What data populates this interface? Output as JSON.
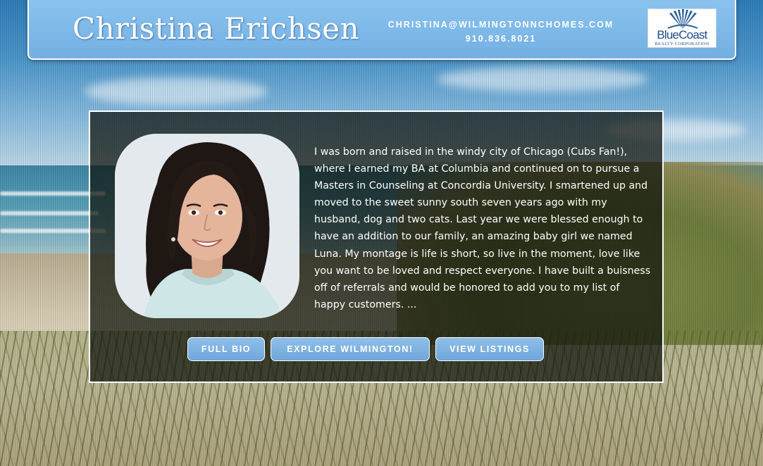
{
  "header": {
    "agent_name": "Christina Erichsen",
    "email": "CHRISTINA@WILMINGTONNCHOMES.COM",
    "phone": "910.836.8021",
    "logo_name": "BlueCoast",
    "logo_subtitle": "REALTY CORPORATION"
  },
  "bio": {
    "text": "I was born and raised in the windy city of Chicago (Cubs Fan!), where I earned my BA at Columbia and continued on to pursue a Masters in Counseling at Concordia University. I smartened up and moved to the sweet sunny south seven years ago with my husband, dog and two cats. Last year we were blessed enough to have an addition to our family, an amazing baby girl we named Luna. My montage is life is short, so live in the moment, love like you want to be loved and respect everyone. I have built a buisness off of referrals and would be honored to add you to my list of happy customers. ..."
  },
  "buttons": {
    "full_bio": "FULL BIO",
    "explore": "EXPLORE WILMINGTON!",
    "listings": "VIEW LISTINGS"
  },
  "colors": {
    "header_blue": "#7db8e8",
    "button_blue": "#7fb2e0",
    "panel_overlay": "#0e120a",
    "logo_blue": "#1f4f86"
  }
}
